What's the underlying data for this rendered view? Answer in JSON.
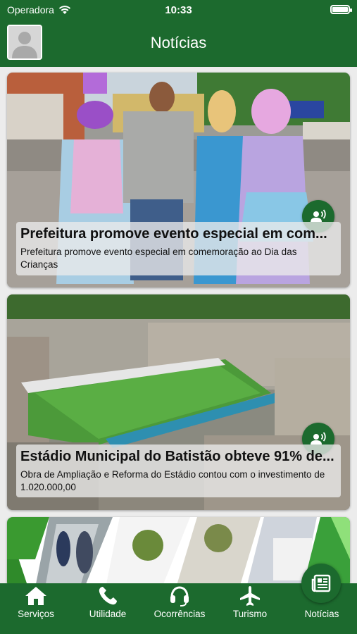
{
  "status_bar": {
    "carrier": "Operadora",
    "time": "10:33"
  },
  "header": {
    "title": "Notícias",
    "avatar_icon": "user-avatar-icon"
  },
  "news": [
    {
      "title": "Prefeitura promove evento especial em com...",
      "description": "Prefeitura promove evento especial em comemoração ao Dia das Crianças",
      "action_icon": "record-voice-icon"
    },
    {
      "title": "Estádio Municipal do Batistão obteve 91% de...",
      "description": "Obra de Ampliação e Reforma do Estádio contou com o investimento de 1.020.000,00",
      "action_icon": "record-voice-icon"
    }
  ],
  "tabs": [
    {
      "label": "Serviços",
      "icon": "home-icon"
    },
    {
      "label": "Utilidade",
      "icon": "phone-icon"
    },
    {
      "label": "Ocorrências",
      "icon": "headset-icon"
    },
    {
      "label": "Turismo",
      "icon": "airplane-icon"
    },
    {
      "label": "Notícias",
      "icon": "newspaper-icon",
      "active": true
    }
  ],
  "colors": {
    "primary": "#1c6a2e",
    "background": "#ececec"
  }
}
